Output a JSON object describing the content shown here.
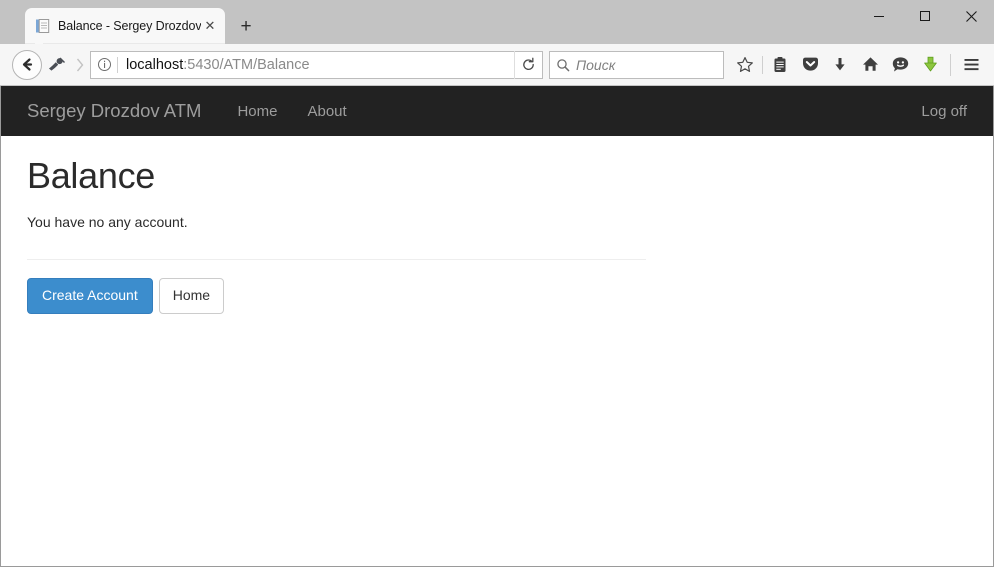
{
  "window": {
    "controls": {
      "minimize": "minimize-button",
      "maximize": "maximize-button",
      "close": "close-button"
    }
  },
  "browser": {
    "tab": {
      "title": "Balance - Sergey Drozdov ...",
      "favicon": "page-icon",
      "close_label": "✕"
    },
    "new_tab_label": "+",
    "toolbar": {
      "back_label": "←",
      "forward_label": "›",
      "identity_icon": "info-icon",
      "reload_label": "⟳",
      "url_host": "localhost",
      "url_path": ":5430/ATM/Balance",
      "url_full": "localhost:5430/ATM/Balance"
    },
    "search": {
      "placeholder": "Поиск",
      "icon": "search-icon"
    },
    "icons": [
      {
        "name": "bookmark-star-icon"
      },
      {
        "name": "reader-list-icon"
      },
      {
        "name": "pocket-icon"
      },
      {
        "name": "downloads-icon"
      },
      {
        "name": "home-icon"
      },
      {
        "name": "feedback-smiley-icon"
      },
      {
        "name": "downthemall-icon"
      },
      {
        "name": "hamburger-menu-icon"
      }
    ]
  },
  "site": {
    "brand": "Sergey Drozdov ATM",
    "nav": [
      {
        "label": "Home"
      },
      {
        "label": "About"
      }
    ],
    "account": {
      "logoff_label": "Log off"
    }
  },
  "page": {
    "title": "Balance",
    "message": "You have no any account.",
    "buttons": {
      "primary": "Create Account",
      "secondary": "Home"
    }
  },
  "colors": {
    "navbar_bg": "#222222",
    "navbar_text": "#9d9d9d",
    "primary_button": "#3c8dcd",
    "primary_button_border": "#357ebd",
    "page_text": "#2b2b2b",
    "titlebar_bg": "#c3c3c3"
  }
}
